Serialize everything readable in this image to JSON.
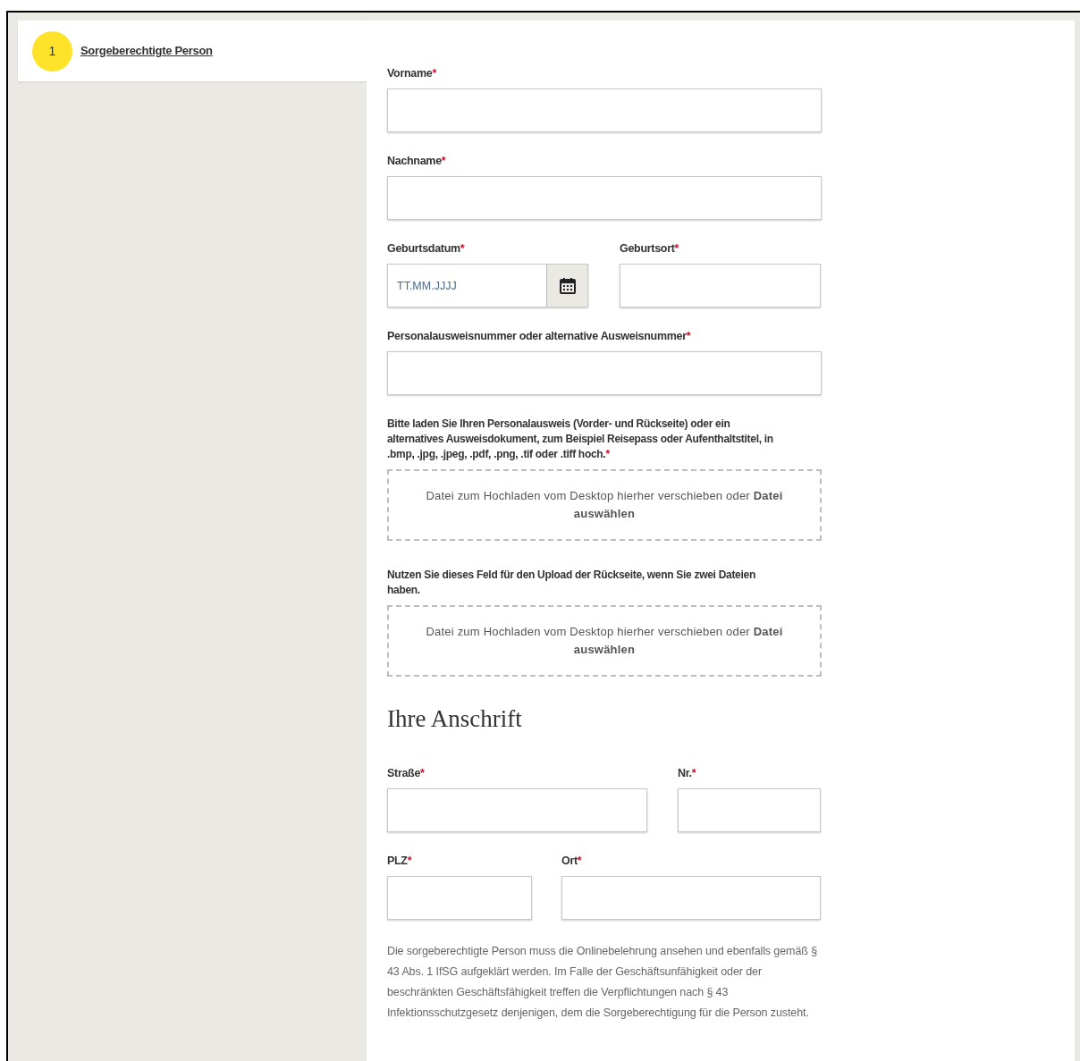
{
  "stepper": {
    "number": "1",
    "label": "Sorgeberechtigte Person"
  },
  "rows": [
    {
      "kind": "single",
      "fields": [
        {
          "label": "Vorname",
          "required_mark": "*",
          "kind": "text"
        }
      ]
    },
    {
      "kind": "single",
      "fields": [
        {
          "label": "Nachname",
          "required_mark": "*",
          "kind": "text"
        }
      ]
    },
    {
      "kind": "halves",
      "fields": [
        {
          "label": "Geburtsdatum",
          "required_mark": "*",
          "kind": "date",
          "placeholder": "TT.MM.JJJJ"
        },
        {
          "label": "Geburtsort",
          "required_mark": "*",
          "kind": "text"
        }
      ]
    },
    {
      "kind": "single",
      "fields": [
        {
          "label": "Personalausweisnummer oder alternative Ausweisnummer",
          "required_mark": "*",
          "kind": "text"
        }
      ]
    },
    {
      "kind": "upload",
      "label": "Bitte laden Sie Ihren Personalausweis (Vorder- und Rückseite) oder ein alternatives Ausweisdokument, zum Beispiel Reisepass oder Aufenthaltstitel, in .bmp, .jpg, .jpeg, .pdf, .png, .tif oder .tiff hoch.",
      "required_mark": "*",
      "drop_text": "Datei zum Hochladen vom Desktop hierher verschieben oder **Datei auswählen**"
    },
    {
      "kind": "upload",
      "label": "Nutzen Sie dieses Feld für den Upload der Rückseite, wenn Sie zwei Dateien haben.",
      "drop_text": "Datei zum Hochladen vom Desktop hierher verschieben oder **Datei auswählen**"
    },
    {
      "kind": "heading",
      "text": "Ihre Anschrift"
    },
    {
      "kind": "widefirst",
      "fields": [
        {
          "label": "Straße",
          "required_mark": "*",
          "kind": "text"
        },
        {
          "label": "Nr.",
          "required_mark": "*",
          "kind": "text"
        }
      ]
    },
    {
      "kind": "narrowfirst",
      "fields": [
        {
          "label": "PLZ",
          "required_mark": "*",
          "kind": "text"
        },
        {
          "label": "Ort",
          "required_mark": "*",
          "kind": "text"
        }
      ]
    },
    {
      "kind": "note",
      "text": "Die sorgeberechtigte Person muss die Onlinebelehrung ansehen und ebenfalls gemäß § 43 Abs. 1 IfSG aufgeklärt werden. Im Falle der Geschäftsunfähigkeit oder der beschränkten Geschäftsfähigkeit treffen die Verpflichtungen nach § 43 Infektionsschutzgesetz denjenigen, dem die Sorgeberechtigung für die Person zusteht."
    }
  ]
}
